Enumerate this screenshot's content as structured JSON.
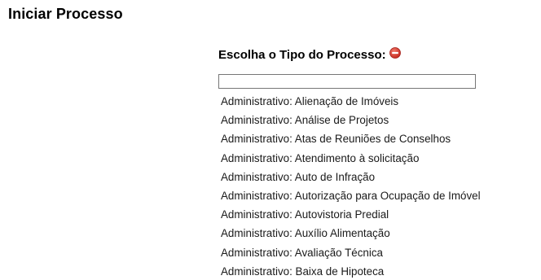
{
  "header": {
    "title": "Iniciar Processo"
  },
  "chooser": {
    "heading": "Escolha o Tipo do Processo:",
    "filter_value": "",
    "icons": {
      "heading_action": "minus-circle-icon"
    },
    "colors": {
      "icon_red": "#d9362b"
    }
  },
  "process_types": [
    "Administrativo: Alienação de Imóveis",
    "Administrativo: Análise de Projetos",
    "Administrativo: Atas de Reuniões de Conselhos",
    "Administrativo: Atendimento à solicitação",
    "Administrativo: Auto de Infração",
    "Administrativo: Autorização para Ocupação de Imóvel",
    "Administrativo: Autovistoria Predial",
    "Administrativo: Auxílio Alimentação",
    "Administrativo: Avaliação Técnica",
    "Administrativo: Baixa de Hipoteca"
  ]
}
